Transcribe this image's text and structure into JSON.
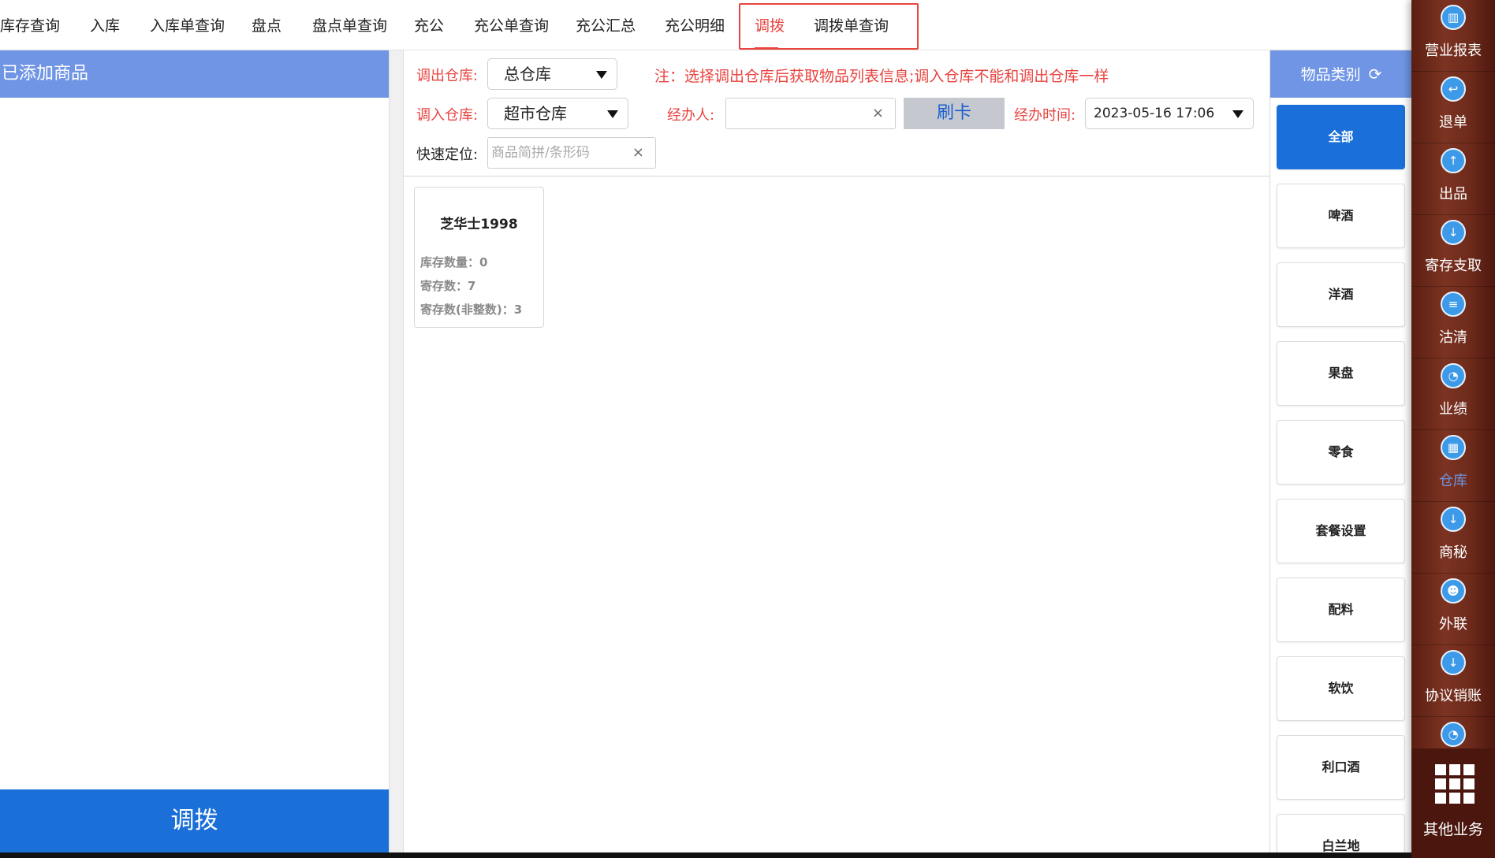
{
  "tabs": [
    {
      "label": "库存查询",
      "active": false
    },
    {
      "label": "入库",
      "active": false
    },
    {
      "label": "入库单查询",
      "active": false
    },
    {
      "label": "盘点",
      "active": false
    },
    {
      "label": "盘点单查询",
      "active": false
    },
    {
      "label": "充公",
      "active": false
    },
    {
      "label": "充公单查询",
      "active": false
    },
    {
      "label": "充公汇总",
      "active": false
    },
    {
      "label": "充公明细",
      "active": false
    },
    {
      "label": "调拨",
      "active": true
    },
    {
      "label": "调拨单查询",
      "active": false
    }
  ],
  "left": {
    "header": "已添加商品",
    "submit_label": "调拨"
  },
  "form": {
    "out_label": "调出仓库:",
    "out_value": "总仓库",
    "note": "注：选择调出仓库后获取物品列表信息;调入仓库不能和调出仓库一样",
    "in_label": "调入仓库:",
    "in_value": "超市仓库",
    "handler_label": "经办人:",
    "handler_value": "",
    "card_label": "刷卡",
    "time_label": "经办时间:",
    "time_value": "2023-05-16 17:06",
    "locate_label": "快速定位:",
    "locate_placeholder": "商品简拼/条形码",
    "clear_glyph": "×"
  },
  "products": [
    {
      "name": "芝华士1998",
      "stock": "库存数量：0",
      "deposit": "寄存数：7",
      "deposit_fraction": "寄存数(非整数)：3"
    }
  ],
  "categories": {
    "header": "物品类别",
    "refresh_glyph": "⟳",
    "items": [
      {
        "label": "全部",
        "active": true
      },
      {
        "label": "啤酒",
        "active": false
      },
      {
        "label": "洋酒",
        "active": false
      },
      {
        "label": "果盘",
        "active": false
      },
      {
        "label": "零食",
        "active": false
      },
      {
        "label": "套餐设置",
        "active": false
      },
      {
        "label": "配料",
        "active": false
      },
      {
        "label": "软饮",
        "active": false
      },
      {
        "label": "利口酒",
        "active": false
      },
      {
        "label": "白兰地",
        "active": false
      }
    ]
  },
  "sidebar": {
    "items": [
      {
        "label": "营业报表",
        "icon": "report-icon",
        "glyph": "▥",
        "active": false
      },
      {
        "label": "退单",
        "icon": "refund-icon",
        "glyph": "↩",
        "active": false
      },
      {
        "label": "出品",
        "icon": "upload-icon",
        "glyph": "↑",
        "active": false
      },
      {
        "label": "寄存支取",
        "icon": "download-icon",
        "glyph": "↓",
        "active": false
      },
      {
        "label": "沽清",
        "icon": "list-icon",
        "glyph": "≡",
        "active": false
      },
      {
        "label": "业绩",
        "icon": "pie-chart-icon",
        "glyph": "◔",
        "active": false
      },
      {
        "label": "仓库",
        "icon": "warehouse-icon",
        "glyph": "▦",
        "active": true
      },
      {
        "label": "商秘",
        "icon": "download-icon",
        "glyph": "↓",
        "active": false
      },
      {
        "label": "外联",
        "icon": "user-icon",
        "glyph": "☻",
        "active": false
      },
      {
        "label": "协议销账",
        "icon": "download-icon",
        "glyph": "↓",
        "active": false
      },
      {
        "label": "",
        "icon": "pie-chart-icon",
        "glyph": "◔",
        "active": false
      }
    ],
    "more_label": "其他业务"
  }
}
